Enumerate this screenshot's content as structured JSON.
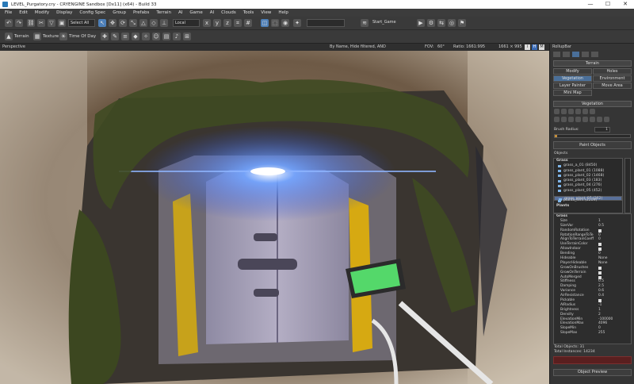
{
  "window": {
    "title": "LEVEL_Purgatory.cry - CRYENGINE Sandbox [Dx11] (x64) - Build 33",
    "min_glyph": "—",
    "max_glyph": "☐",
    "close_glyph": "✕"
  },
  "menu": [
    "File",
    "Edit",
    "Modify",
    "Display",
    "Config Spec",
    "Group",
    "Prefabs",
    "Terrain",
    "AI",
    "Game",
    "AI",
    "Clouds",
    "Tools",
    "View",
    "Help"
  ],
  "toolbar": {
    "select_all_label": "Select All",
    "coord_system": "Local",
    "layer_select": "Start_Game",
    "terrain_label": "Terrain",
    "texture_label": "Texture",
    "time_of_day_label": "Time Of Day"
  },
  "viewport": {
    "name": "Perspective",
    "filter": "By Name, Hide filtered, AND",
    "fov_label": "FOV:",
    "fov_value": "60°",
    "ratio_label": "Ratio: 1661:995",
    "resolution": "1661 × 995",
    "btn_i": "i",
    "btn_h": "H",
    "btn_m": "M"
  },
  "rollup": {
    "title": "RollupBar",
    "section_terrain": "Terrain",
    "buttons": [
      "Modify",
      "Holes",
      "Vegetation",
      "Environment",
      "Layer Painter",
      "Move Area",
      "Mini Map"
    ],
    "section_vegetation": "Vegetation",
    "brush_radius_label": "Brush Radius:",
    "brush_radius_value": "1",
    "paint_objects": "Paint Objects",
    "objects_label": "Objects",
    "groups": [
      {
        "name": "Grass",
        "items": [
          "grass_a_01 (8450)",
          "grass_plant_01 (1088)",
          "grass_plant_02 (1468)",
          "grass_plant_03 (183)",
          "grass_plant_04 (276)",
          "grass_plant_05 (452)",
          "grass_plant_06 (277)",
          "grass_plant_07 (262)",
          "plants_fern (2209)"
        ]
      },
      {
        "name": "Plants",
        "items": [
          "Grass"
        ]
      }
    ],
    "properties": [
      {
        "name": "Size",
        "value": "1"
      },
      {
        "name": "SizeVar",
        "value": "0.5"
      },
      {
        "name": "RandomRotation",
        "value": "check"
      },
      {
        "name": "RotationRangeToTe",
        "value": "0"
      },
      {
        "name": "AlignToTerrainCoeff",
        "value": "0"
      },
      {
        "name": "UseTerrainColor",
        "value": "check"
      },
      {
        "name": "AllowIndoor",
        "value": "check"
      },
      {
        "name": "Bending",
        "value": "0"
      },
      {
        "name": "Hideable",
        "value": "None"
      },
      {
        "name": "PlayerHideable",
        "value": "None"
      },
      {
        "name": "GrowOnBrushes",
        "value": "check"
      },
      {
        "name": "GrowOnTerrain",
        "value": "check"
      },
      {
        "name": "AutoMerged",
        "value": "check"
      },
      {
        "name": "Stiffness",
        "value": "0.5"
      },
      {
        "name": "Damping",
        "value": "2.5"
      },
      {
        "name": "Variance",
        "value": "0.6"
      },
      {
        "name": "AirResistance",
        "value": "0.4"
      },
      {
        "name": "Pickable",
        "value": "check"
      },
      {
        "name": "AIRadius",
        "value": "-1"
      },
      {
        "name": "Brightness",
        "value": "1"
      },
      {
        "name": "Density",
        "value": "2"
      },
      {
        "name": "ElevationMin",
        "value": "-100000"
      },
      {
        "name": "ElevationMax",
        "value": "4096"
      },
      {
        "name": "SlopeMin",
        "value": "0"
      },
      {
        "name": "SlopeMax",
        "value": "255"
      }
    ],
    "total_objects": "Total Objects: 31",
    "total_instances": "Total Instances: 14234",
    "object_preview": "Object Preview"
  },
  "colors": {
    "accent": "#4a6f99",
    "panel": "#353535",
    "hologram": "#54d86a"
  }
}
